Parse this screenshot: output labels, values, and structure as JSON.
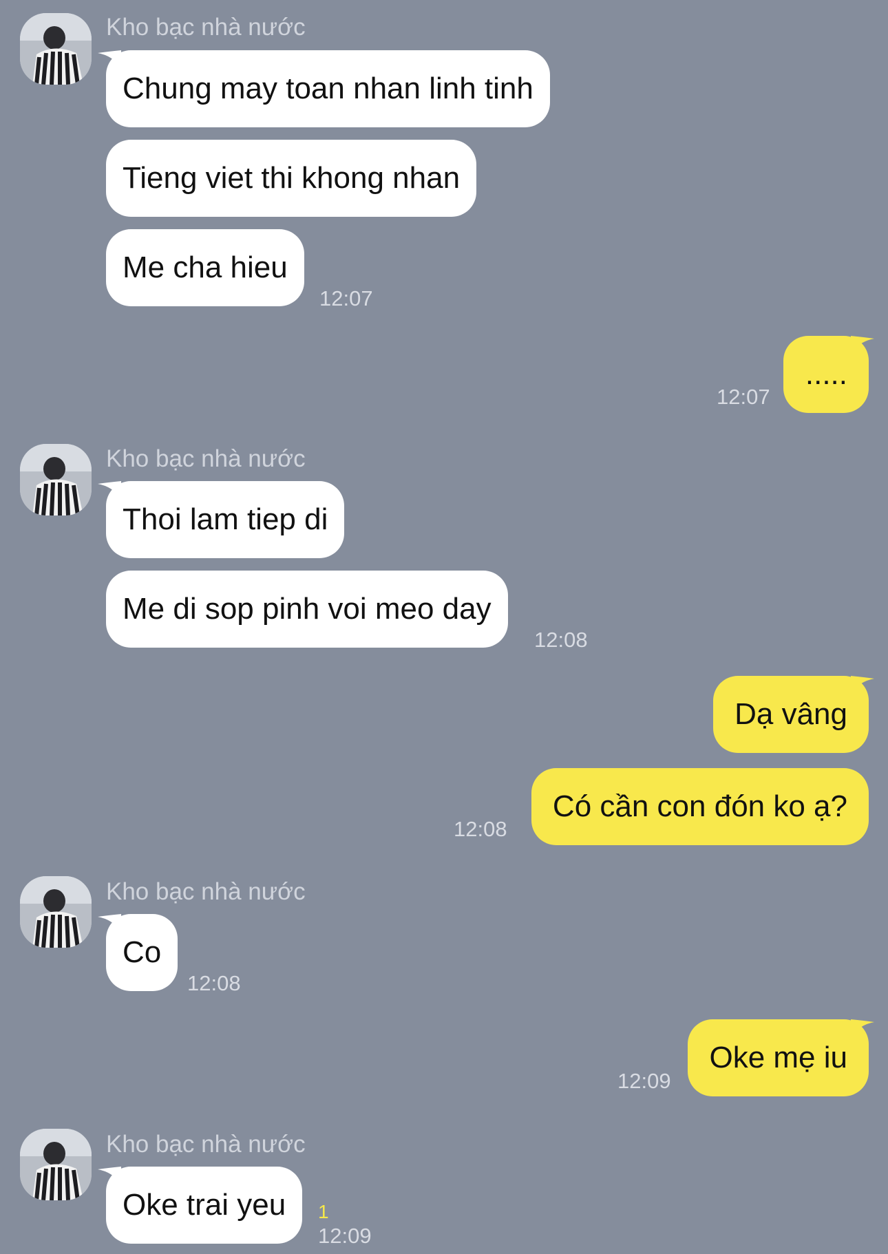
{
  "chat": {
    "sender_name": "Kho bạc nhà nước",
    "group1": {
      "messages": [
        "Chung may toan nhan linh tinh",
        "Tieng viet thi khong nhan",
        "Me cha hieu"
      ],
      "time": "12:07"
    },
    "out1": {
      "message": ".....",
      "time": "12:07"
    },
    "group2": {
      "messages": [
        "Thoi lam tiep di",
        "Me di sop pinh voi meo day"
      ],
      "time": "12:08"
    },
    "out2": {
      "messages": [
        "Dạ vâng",
        "Có cần con đón ko ạ?"
      ],
      "time": "12:08"
    },
    "group3": {
      "messages": [
        "Co"
      ],
      "time": "12:08"
    },
    "out3": {
      "message": "Oke mẹ iu",
      "time": "12:09"
    },
    "group4": {
      "messages": [
        "Oke trai yeu"
      ],
      "time": "12:09",
      "unread_count": "1"
    }
  },
  "colors": {
    "background": "#858d9c",
    "incoming_bubble": "#ffffff",
    "outgoing_bubble": "#f8e84c",
    "unread_indicator": "#f6e84a"
  }
}
